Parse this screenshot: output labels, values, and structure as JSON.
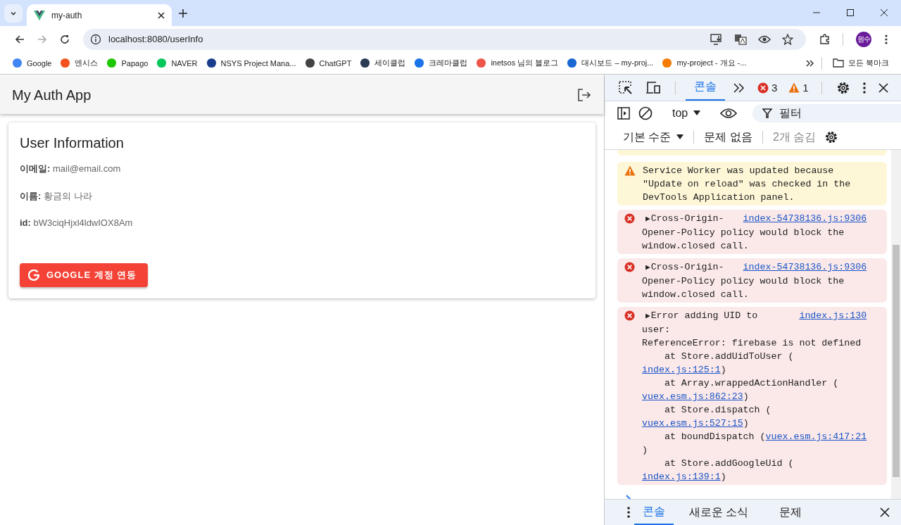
{
  "browser": {
    "tab": {
      "title": "my-auth",
      "selected": true
    },
    "address": "localhost:8080/userInfo",
    "profile": "원수",
    "bookmarks": [
      {
        "label": "Google",
        "color": "#4285f4"
      },
      {
        "label": "엔시스",
        "color": "#f4511e"
      },
      {
        "label": "Papago",
        "color": "#1ec800"
      },
      {
        "label": "NAVER",
        "color": "#03c75a"
      },
      {
        "label": "NSYS Project Mana...",
        "color": "#1a3c8c"
      },
      {
        "label": "ChatGPT",
        "color": "#444444"
      },
      {
        "label": "세이클럽",
        "color": "#2b3a55"
      },
      {
        "label": "크레마클럽",
        "color": "#1a73e8"
      },
      {
        "label": "inetsos 님의 블로그",
        "color": "#f0554a"
      },
      {
        "label": "대시보드 – my-proj...",
        "color": "#1967d2"
      },
      {
        "label": "my-project - 개요 -...",
        "color": "#f57c00"
      }
    ],
    "all_bookmarks": "모든 북마크"
  },
  "app": {
    "title": "My Auth App",
    "card": {
      "heading": "User Information",
      "fields": [
        {
          "label": "이메일:",
          "value": "mail@email.com"
        },
        {
          "label": "이름:",
          "value": "황금의 나라"
        },
        {
          "label": "id:",
          "value": "bW3ciqHjxl4ldwIOX8Am"
        }
      ],
      "button": "GOOGLE 계정 연동"
    }
  },
  "devtools": {
    "tabs": [
      {
        "label": "콘솔",
        "selected": true
      }
    ],
    "errors": "3",
    "warnings": "1",
    "context": "top",
    "filter_placeholder": "필터",
    "levels": "기본 수준",
    "issues": "문제 없음",
    "hidden": "2개 숨김",
    "messages": [
      {
        "kind": "warning",
        "text": "Service Worker was updated because \"Update on reload\" was checked in the DevTools Application panel."
      },
      {
        "kind": "error",
        "toggle": "▶",
        "text": "Cross-Origin-",
        "source": "index-54738136.js:9306",
        "continuation": "Opener-Policy policy would block the window.closed call."
      },
      {
        "kind": "error",
        "toggle": "▶",
        "text": "Cross-Origin-",
        "source": "index-54738136.js:9306",
        "continuation": "Opener-Policy policy would block the window.closed call."
      },
      {
        "kind": "error",
        "toggle": "▶",
        "text": "Error adding UID to",
        "source": "index.js:130",
        "continuation": "user:",
        "detail": "ReferenceError: firebase is not defined",
        "stack": [
          {
            "call": "at Store.addUidToUser (",
            "link": "index.js:125:1",
            "end": ")"
          },
          {
            "call": "at Array.wrappedActionHandler (",
            "link": "vuex.esm.js:862:23",
            "end": ")"
          },
          {
            "call": "at Store.dispatch (",
            "link": "vuex.esm.js:527:15",
            "end": ")"
          },
          {
            "call": "at boundDispatch (",
            "link": "vuex.esm.js:417:21",
            "end": ")"
          },
          {
            "call": "at Store.addGoogleUid (",
            "link": "index.js:139:1",
            "end": ")"
          }
        ]
      }
    ],
    "drawer_tabs": [
      {
        "label": "콘솔",
        "selected": true
      },
      {
        "label": "새로운 소식",
        "selected": false
      },
      {
        "label": "문제",
        "selected": false
      }
    ]
  }
}
